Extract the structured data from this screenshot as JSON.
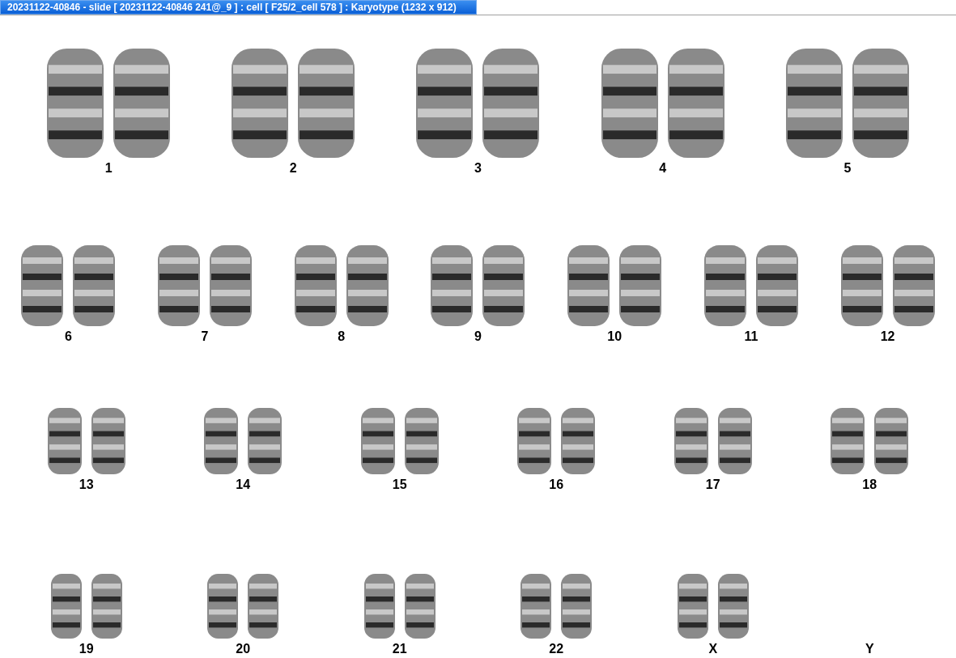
{
  "title_bar": {
    "title": "20231122-40846 - slide [ 20231122-40846 241@_9 ] : cell [ F25/2_cell 578 ] : Karyotype  (1232 x 912)"
  },
  "rows": [
    {
      "items": [
        {
          "label": "1",
          "kind": "pair"
        },
        {
          "label": "2",
          "kind": "pair"
        },
        {
          "label": "3",
          "kind": "pair"
        },
        {
          "label": "4",
          "kind": "pair"
        },
        {
          "label": "5",
          "kind": "pair"
        }
      ]
    },
    {
      "items": [
        {
          "label": "6",
          "kind": "pair"
        },
        {
          "label": "7",
          "kind": "pair"
        },
        {
          "label": "8",
          "kind": "pair"
        },
        {
          "label": "9",
          "kind": "pair"
        },
        {
          "label": "10",
          "kind": "pair"
        },
        {
          "label": "11",
          "kind": "pair"
        },
        {
          "label": "12",
          "kind": "pair"
        }
      ]
    },
    {
      "items": [
        {
          "label": "13",
          "kind": "pair"
        },
        {
          "label": "14",
          "kind": "pair"
        },
        {
          "label": "15",
          "kind": "pair"
        },
        {
          "label": "16",
          "kind": "pair"
        },
        {
          "label": "17",
          "kind": "pair"
        },
        {
          "label": "18",
          "kind": "pair"
        }
      ]
    },
    {
      "items": [
        {
          "label": "19",
          "kind": "pair"
        },
        {
          "label": "20",
          "kind": "pair"
        },
        {
          "label": "21",
          "kind": "pair"
        },
        {
          "label": "22",
          "kind": "pair"
        },
        {
          "label": "X",
          "kind": "pair"
        },
        {
          "label": "Y",
          "kind": "empty"
        }
      ]
    }
  ]
}
